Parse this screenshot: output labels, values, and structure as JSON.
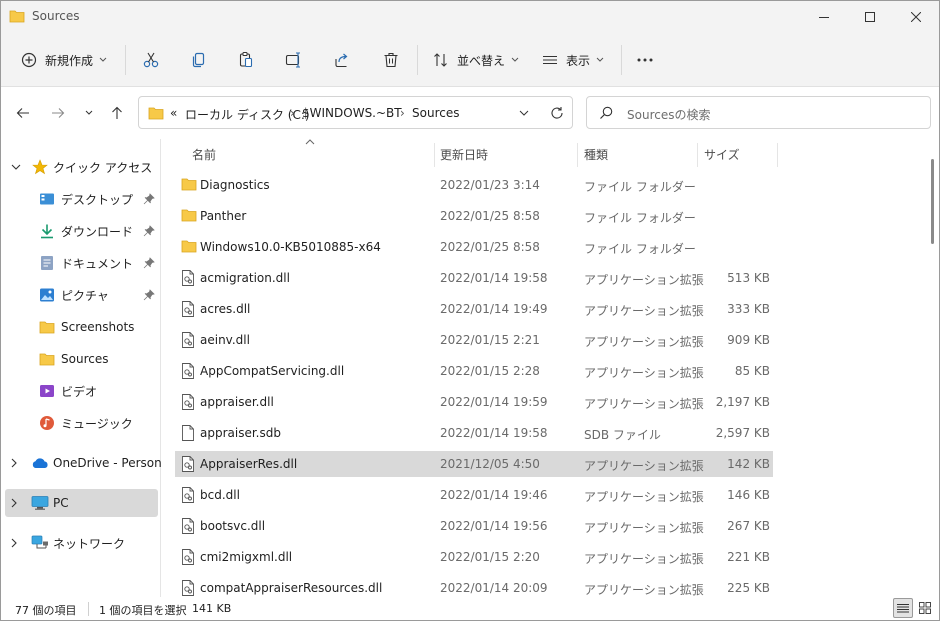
{
  "window": {
    "title": "Sources",
    "controls": [
      "minimize-icon",
      "maximize-icon",
      "close-icon"
    ]
  },
  "toolbar": {
    "new_label": "新規作成",
    "sort_label": "並べ替え",
    "view_label": "表示",
    "icons": [
      "cut-icon",
      "copy-icon",
      "paste-icon",
      "rename-icon",
      "share-icon",
      "delete-icon",
      "more-icon"
    ]
  },
  "nav": {
    "breadcrumb_overflow": "«",
    "breadcrumbs": [
      "ローカル ディスク (C:)",
      "$WINDOWS.~BT",
      "Sources"
    ],
    "search_placeholder": "Sourcesの検索"
  },
  "sidebar": {
    "items": [
      {
        "label": "クイック アクセス",
        "icon": "star-icon",
        "pinned": false
      },
      {
        "label": "デスクトップ",
        "icon": "desktop-icon",
        "pinned": true
      },
      {
        "label": "ダウンロード",
        "icon": "download-icon",
        "pinned": true
      },
      {
        "label": "ドキュメント",
        "icon": "document-icon",
        "pinned": true
      },
      {
        "label": "ピクチャ",
        "icon": "pictures-icon",
        "pinned": true
      },
      {
        "label": "Screenshots",
        "icon": "folder-icon",
        "pinned": false
      },
      {
        "label": "Sources",
        "icon": "folder-icon",
        "pinned": false
      },
      {
        "label": "ビデオ",
        "icon": "video-icon",
        "pinned": false
      },
      {
        "label": "ミュージック",
        "icon": "music-icon",
        "pinned": false
      },
      {
        "label": "OneDrive - Personal",
        "icon": "cloud-icon",
        "pinned": false
      },
      {
        "label": "PC",
        "icon": "pc-icon",
        "pinned": false,
        "selected": true
      },
      {
        "label": "ネットワーク",
        "icon": "network-icon",
        "pinned": false
      }
    ]
  },
  "columns": {
    "name": "名前",
    "date": "更新日時",
    "type": "種類",
    "size": "サイズ"
  },
  "files": [
    {
      "name": "Diagnostics",
      "date": "2022/01/23 3:14",
      "type": "ファイル フォルダー",
      "size": "",
      "kind": "folder"
    },
    {
      "name": "Panther",
      "date": "2022/01/25 8:58",
      "type": "ファイル フォルダー",
      "size": "",
      "kind": "folder"
    },
    {
      "name": "Windows10.0-KB5010885-x64",
      "date": "2022/01/25 8:58",
      "type": "ファイル フォルダー",
      "size": "",
      "kind": "folder"
    },
    {
      "name": "acmigration.dll",
      "date": "2022/01/14 19:58",
      "type": "アプリケーション拡張",
      "size": "513 KB",
      "kind": "dll"
    },
    {
      "name": "acres.dll",
      "date": "2022/01/14 19:49",
      "type": "アプリケーション拡張",
      "size": "333 KB",
      "kind": "dll"
    },
    {
      "name": "aeinv.dll",
      "date": "2022/01/15 2:21",
      "type": "アプリケーション拡張",
      "size": "909 KB",
      "kind": "dll"
    },
    {
      "name": "AppCompatServicing.dll",
      "date": "2022/01/15 2:28",
      "type": "アプリケーション拡張",
      "size": "85 KB",
      "kind": "dll"
    },
    {
      "name": "appraiser.dll",
      "date": "2022/01/14 19:59",
      "type": "アプリケーション拡張",
      "size": "2,197 KB",
      "kind": "dll"
    },
    {
      "name": "appraiser.sdb",
      "date": "2022/01/14 19:58",
      "type": "SDB ファイル",
      "size": "2,597 KB",
      "kind": "file"
    },
    {
      "name": "AppraiserRes.dll",
      "date": "2021/12/05 4:50",
      "type": "アプリケーション拡張",
      "size": "142 KB",
      "kind": "dll",
      "selected": true
    },
    {
      "name": "bcd.dll",
      "date": "2022/01/14 19:46",
      "type": "アプリケーション拡張",
      "size": "146 KB",
      "kind": "dll"
    },
    {
      "name": "bootsvc.dll",
      "date": "2022/01/14 19:56",
      "type": "アプリケーション拡張",
      "size": "267 KB",
      "kind": "dll"
    },
    {
      "name": "cmi2migxml.dll",
      "date": "2022/01/15 2:20",
      "type": "アプリケーション拡張",
      "size": "221 KB",
      "kind": "dll"
    },
    {
      "name": "compatAppraiserResources.dll",
      "date": "2022/01/14 20:09",
      "type": "アプリケーション拡張",
      "size": "225 KB",
      "kind": "dll"
    }
  ],
  "status": {
    "item_count": "77 個の項目",
    "selection": "1 個の項目を選択",
    "selection_size": "141 KB"
  },
  "colors": {
    "folder": "#f7c948",
    "accent": "#0067c0",
    "selected_row": "#d9d9d9"
  }
}
